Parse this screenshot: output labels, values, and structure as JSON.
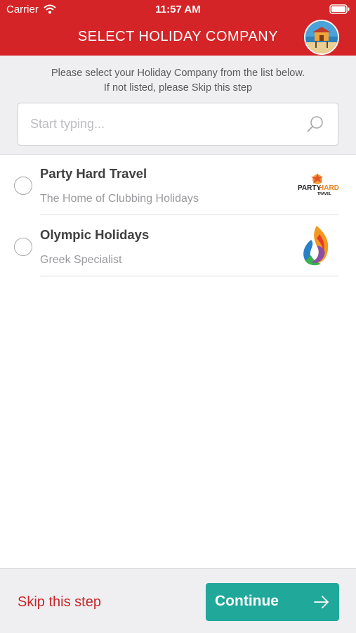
{
  "status_bar": {
    "carrier": "Carrier",
    "time": "11:57 AM"
  },
  "header": {
    "title": "SELECT HOLIDAY COMPANY",
    "avatar_icon": "beach-hut-avatar",
    "accent_color": "#d42427"
  },
  "instructions": {
    "line1": "Please select your Holiday Company from the list below.",
    "line2": "If not listed, please Skip this step"
  },
  "search": {
    "placeholder": "Start typing...",
    "value": "",
    "icon": "search-icon"
  },
  "companies": [
    {
      "name": "Party Hard Travel",
      "tagline": "The Home of Clubbing Holidays",
      "logo_text": "PARTY",
      "logo_text2": "HARD",
      "logo_text3": "TRAVEL",
      "selected": false
    },
    {
      "name": "Olympic Holidays",
      "tagline": "Greek Specialist",
      "logo_icon": "flame-logo",
      "selected": false
    }
  ],
  "footer": {
    "skip_label": "Skip this step",
    "continue_label": "Continue",
    "continue_color": "#20a89a"
  }
}
